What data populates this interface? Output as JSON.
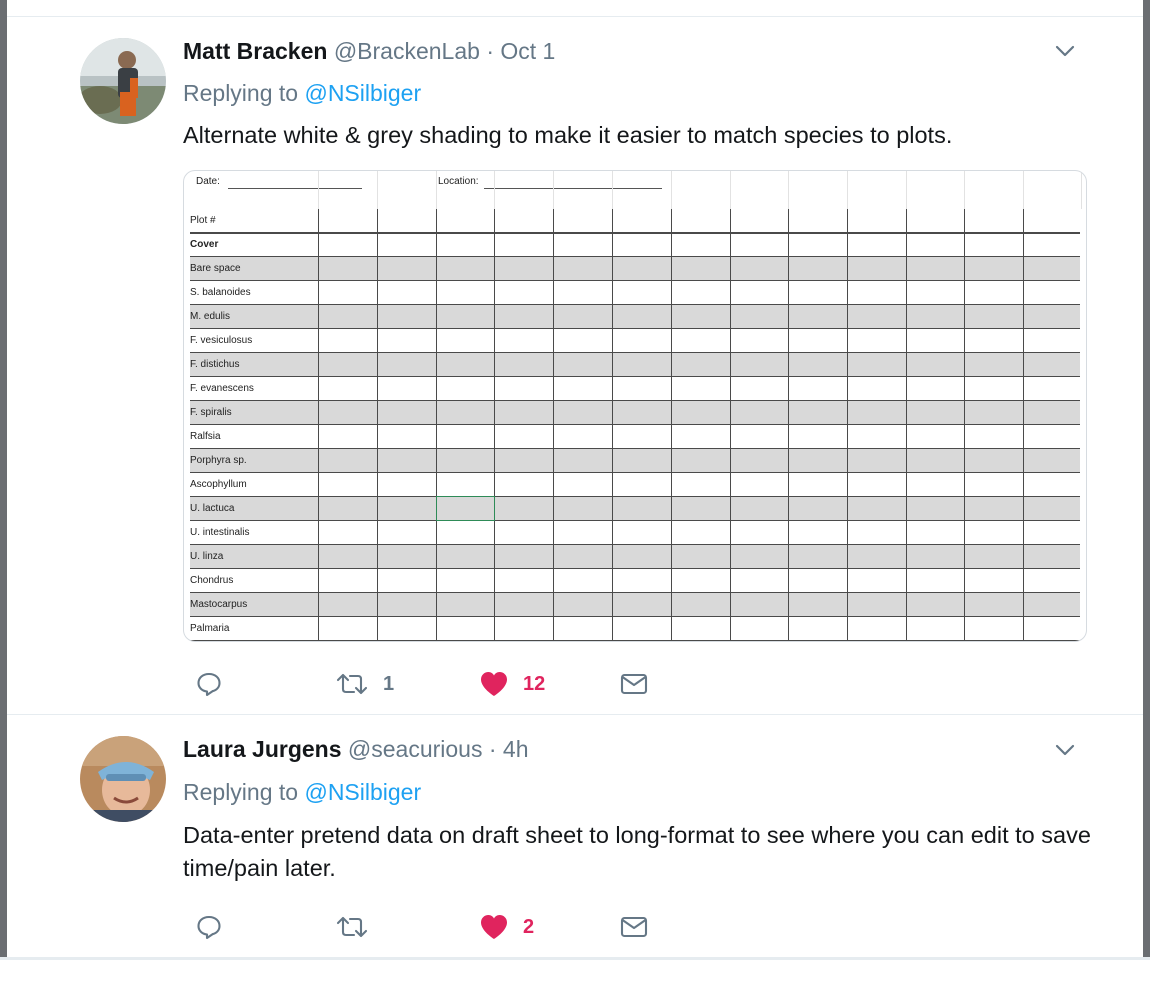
{
  "tweets": [
    {
      "name": "Matt Bracken",
      "handle": "@BrackenLab",
      "separator": "·",
      "time": "Oct 1",
      "replying_prefix": "Replying to",
      "replying_to": "@NSilbiger",
      "text": "Alternate white & grey shading to make it easier to match species to plots.",
      "counts": {
        "reply": "",
        "retweet": "1",
        "like": "12"
      }
    },
    {
      "name": "Laura Jurgens",
      "handle": "@seacurious",
      "separator": "·",
      "time": "4h",
      "replying_prefix": "Replying to",
      "replying_to": "@NSilbiger",
      "text": "Data-enter pretend data on draft sheet to long-format to see where you can edit to save time/pain later.",
      "counts": {
        "reply": "",
        "retweet": "",
        "like": "2"
      }
    }
  ],
  "sheet": {
    "date_label": "Date:",
    "location_label": "Location:",
    "rows": [
      "Plot #",
      "Cover",
      "Bare space",
      "S. balanoides",
      "M. edulis",
      "F. vesiculosus",
      "F. distichus",
      "F. evanescens",
      "F. spiralis",
      "Ralfsia",
      "Porphyra sp.",
      "Ascophyllum",
      "U. lactuca",
      "U. intestinalis",
      "U. linza",
      "Chondrus",
      "Mastocarpus",
      "Palmaria"
    ],
    "shaded_rows": [
      false,
      false,
      true,
      false,
      true,
      false,
      true,
      false,
      true,
      false,
      true,
      false,
      true,
      false,
      true,
      false,
      true,
      false
    ]
  },
  "colors": {
    "accent": "#1da1f2",
    "like": "#e0245e",
    "muted": "#657786",
    "text": "#14171a",
    "row_shade": "#d9d9d9"
  },
  "icons": {
    "reply": "speech-bubble-icon",
    "retweet": "retweet-icon",
    "like": "heart-icon",
    "dm": "envelope-icon",
    "menu": "chevron-down-icon"
  }
}
